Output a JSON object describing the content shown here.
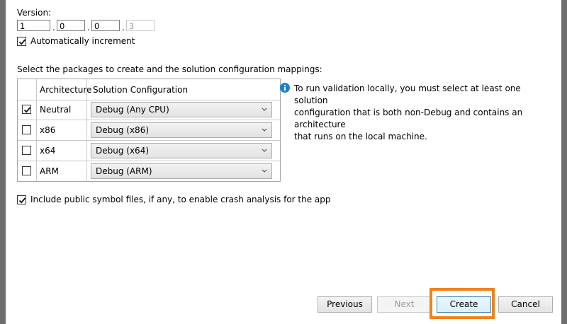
{
  "version": {
    "label": "Version:",
    "parts": [
      "1",
      "0",
      "0",
      "3"
    ],
    "separator": "."
  },
  "auto_increment": {
    "label": "Automatically increment",
    "checked": true
  },
  "packages": {
    "label": "Select the packages to create and the solution configuration mappings:",
    "columns": [
      "Architecture",
      "Solution Configuration"
    ],
    "rows": [
      {
        "architecture": "Neutral",
        "configuration": "Debug (Any CPU)",
        "checked": true
      },
      {
        "architecture": "x86",
        "configuration": "Debug (x86)",
        "checked": false
      },
      {
        "architecture": "x64",
        "configuration": "Debug (x64)",
        "checked": false
      },
      {
        "architecture": "ARM",
        "configuration": "Debug (ARM)",
        "checked": false
      }
    ]
  },
  "info": {
    "icon": "info-icon",
    "lines": [
      "To run validation locally, you must select at least one solution",
      "configuration that is both non-Debug and contains an architecture",
      "that runs on the local machine."
    ]
  },
  "symbols": {
    "label": "Include public symbol files, if any, to enable crash analysis for the app",
    "checked": true
  },
  "buttons": {
    "previous": "Previous",
    "next": "Next",
    "create": "Create",
    "cancel": "Cancel"
  },
  "colors": {
    "highlight": "#f0821e",
    "info_blue": "#1e7fd2"
  }
}
